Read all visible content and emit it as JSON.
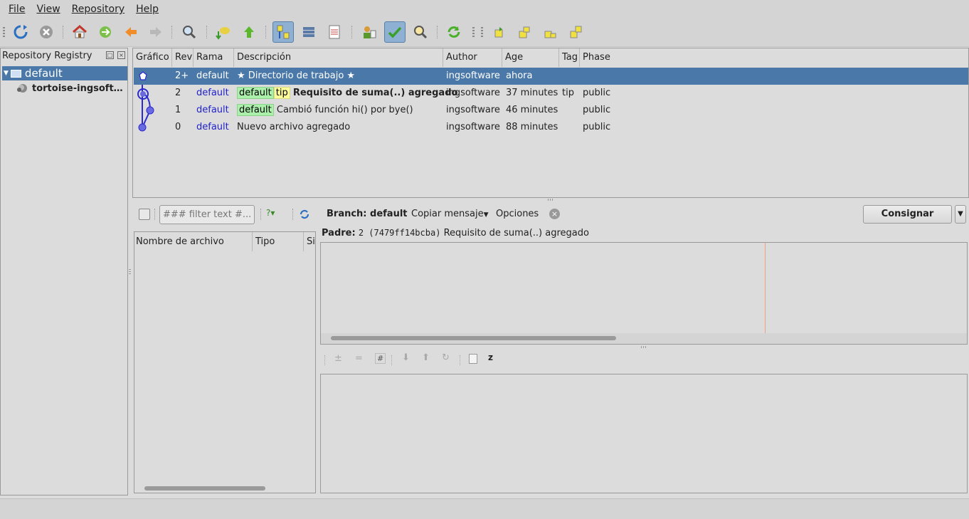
{
  "menu": {
    "file": "File",
    "view": "View",
    "repository": "Repository",
    "help": "Help"
  },
  "toolbar_icons": [
    "refresh-icon",
    "stop-icon",
    "home-icon",
    "synchronize-icon",
    "back-icon",
    "forward-icon",
    "search-icon",
    "pull-icon",
    "push-icon",
    "branch-graph-icon",
    "filelist-icon",
    "log-icon",
    "manifest-icon",
    "commit-icon",
    "grep-icon",
    "sync-icon",
    "tag-icon-1",
    "tag-icon-2",
    "tag-icon-3",
    "tag-icon-4"
  ],
  "sidebar": {
    "title": "Repository Registry",
    "group": "default",
    "repo": "tortoise-ingsoft…"
  },
  "graph": {
    "columns": [
      "Gráfico",
      "Rev",
      "Rama",
      "Descripción",
      "Author",
      "Age",
      "Tag",
      "Phase"
    ],
    "rows": [
      {
        "rev": "2+",
        "branch": "default",
        "desc": "★ Directorio de trabajo ★",
        "author": "ingsoftware",
        "age": "ahora",
        "tag": "",
        "phase": ""
      },
      {
        "rev": "2",
        "branch": "default",
        "label_branch": "default",
        "label_tag": "tip",
        "desc": "Requisito de suma(..) agregado",
        "author": "ingsoftware",
        "age": "37 minutes",
        "tag": "tip",
        "phase": "public"
      },
      {
        "rev": "1",
        "branch": "default",
        "label_branch": "default",
        "desc": "Cambió función hi() por bye()",
        "author": "ingsoftware",
        "age": "46 minutes",
        "tag": "",
        "phase": "public"
      },
      {
        "rev": "0",
        "branch": "default",
        "desc": "Nuevo archivo agregado",
        "author": "ingsoftware",
        "age": "88 minutes",
        "tag": "",
        "phase": "public"
      }
    ]
  },
  "commit": {
    "filter_placeholder": "### filter text #...",
    "branch_label": "Branch: default",
    "copy_message": "Copiar mensaje",
    "options": "Opciones",
    "commit_button": "Consignar",
    "parent_label": "Padre:",
    "parent_value": "2 (7479ff14bcba)",
    "parent_desc": "Requisito de suma(..) agregado"
  },
  "files": {
    "columns": [
      "Nombre de archivo",
      "Tipo",
      "Si"
    ]
  },
  "colors": {
    "selection": "#4a78a8",
    "branch_label": "#aaf0aa",
    "tag_label": "#ffff99",
    "graph_line": "#2b2bd0"
  }
}
